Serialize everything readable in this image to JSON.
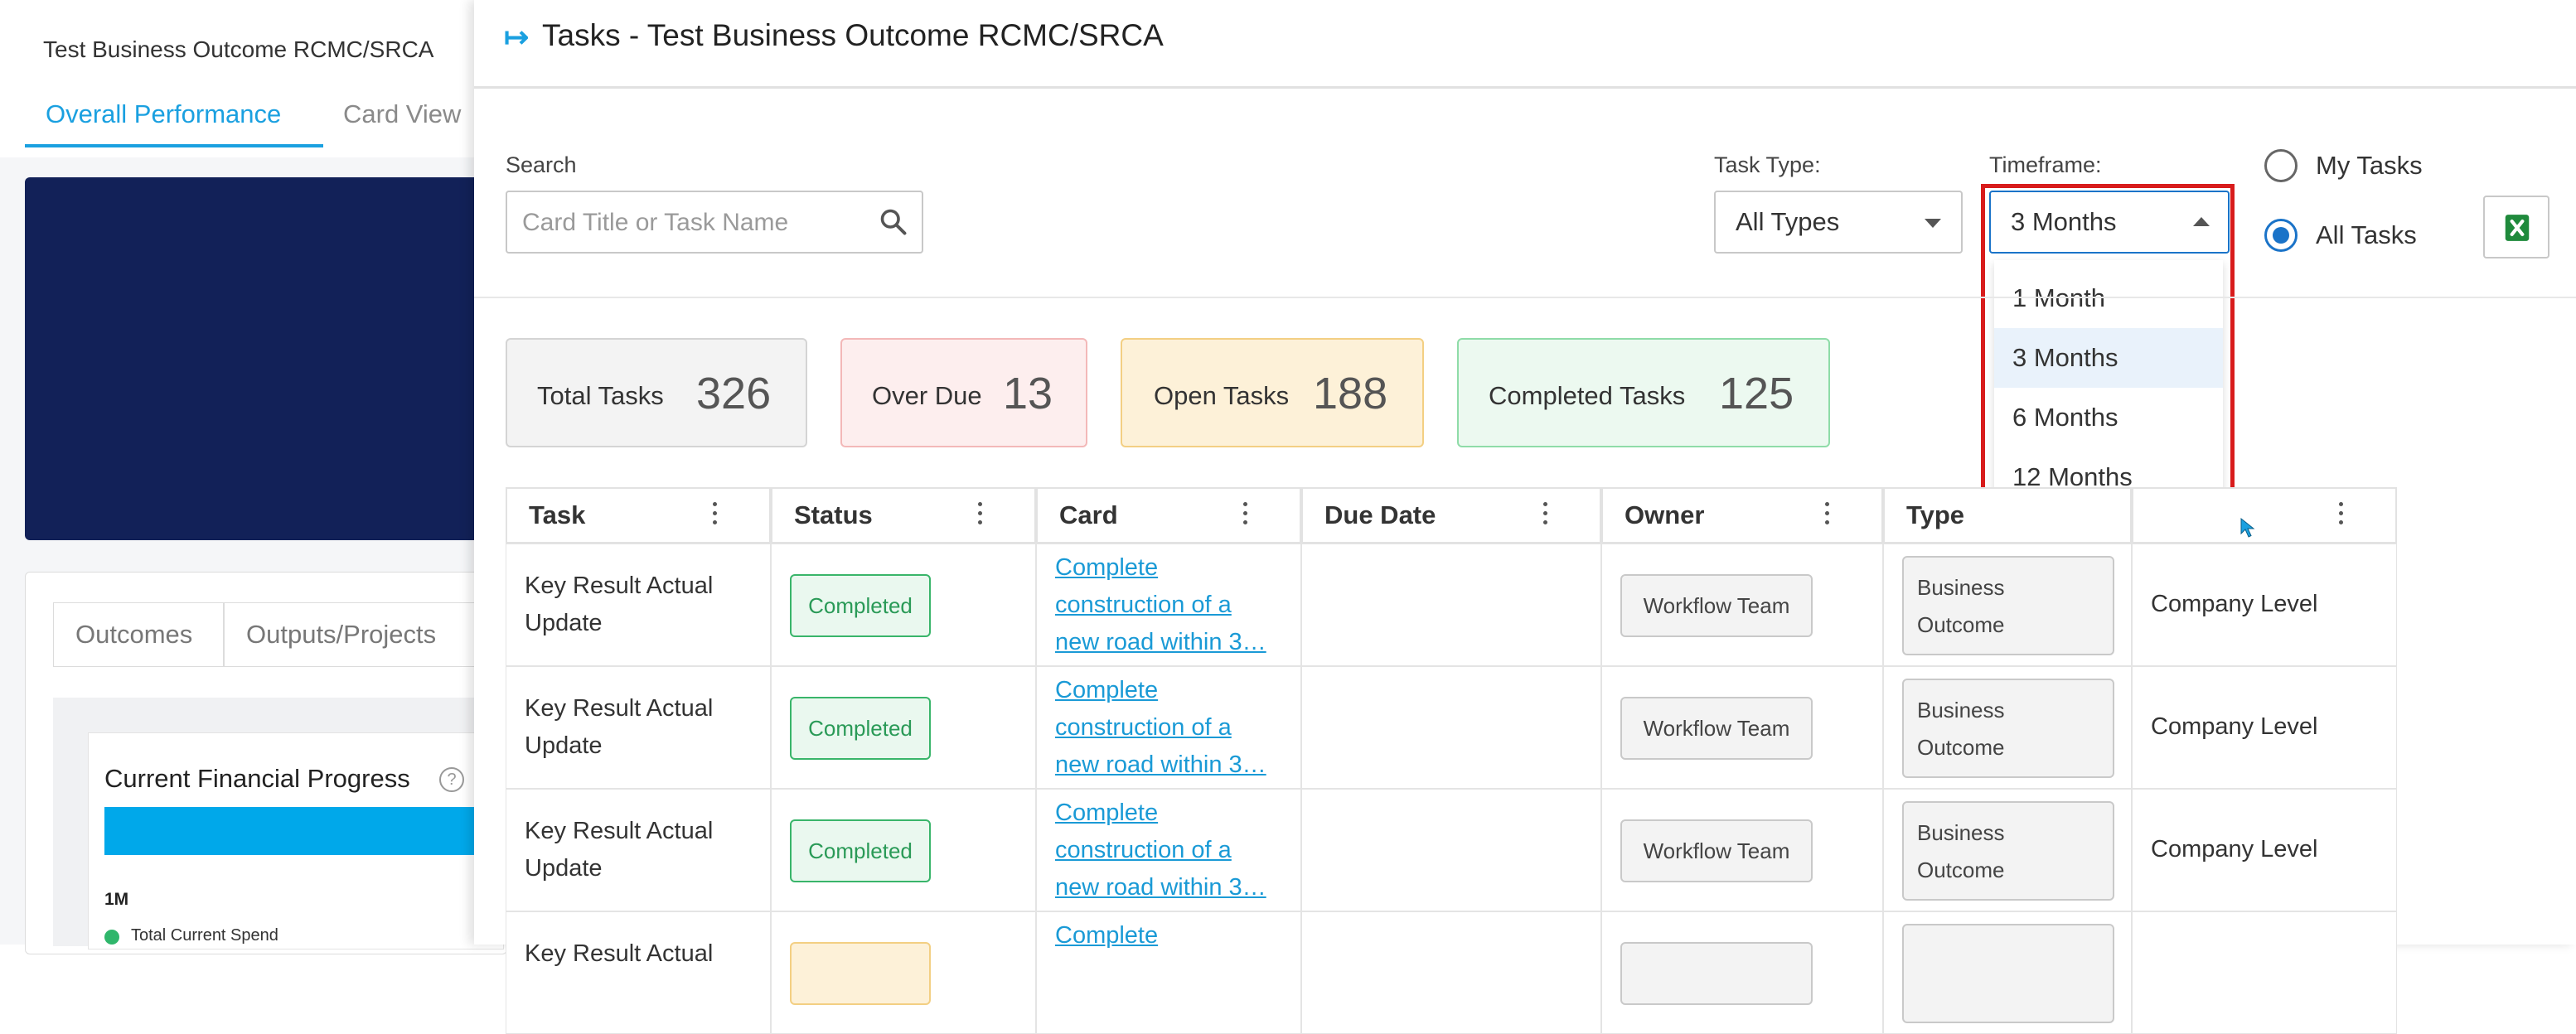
{
  "background": {
    "title": "Test Business Outcome RCMC/SRCA",
    "tabs": [
      {
        "label": "Overall Performance",
        "active": true
      },
      {
        "label": "Card View",
        "active": false
      }
    ],
    "subtabs": [
      "Outcomes",
      "Outputs/Projects"
    ],
    "panel_title": "Current Financial Progress",
    "scale_label": "1M",
    "legend": "Total Current Spend"
  },
  "drawer": {
    "title": "Tasks - Test Business Outcome RCMC/SRCA",
    "search": {
      "label": "Search",
      "placeholder": "Card Title or Task Name"
    },
    "task_type": {
      "label": "Task Type:",
      "value": "All Types"
    },
    "timeframe": {
      "label": "Timeframe:",
      "value": "3 Months",
      "options": [
        "1 Month",
        "3 Months",
        "6 Months",
        "12 Months"
      ],
      "selected_index": 1
    },
    "radios": [
      {
        "label": "My Tasks",
        "checked": false
      },
      {
        "label": "All Tasks",
        "checked": true
      }
    ],
    "stats": [
      {
        "label": "Total Tasks",
        "value": "326"
      },
      {
        "label": "Over Due",
        "value": "13"
      },
      {
        "label": "Open Tasks",
        "value": "188"
      },
      {
        "label": "Completed Tasks",
        "value": "125"
      }
    ],
    "table": {
      "columns": [
        "Task",
        "Status",
        "Card",
        "Due Date",
        "Owner",
        "Type",
        ""
      ],
      "rows": [
        {
          "task": [
            "Key Result Actual",
            "Update"
          ],
          "status": "Completed",
          "card": [
            "Complete",
            "construction of a",
            "new road within 3…"
          ],
          "due": "",
          "owner": "Workflow Team",
          "type": [
            "Business",
            "Outcome"
          ],
          "level": "Company Level"
        },
        {
          "task": [
            "Key Result Actual",
            "Update"
          ],
          "status": "Completed",
          "card": [
            "Complete",
            "construction of a",
            "new road within 3…"
          ],
          "due": "",
          "owner": "Workflow Team",
          "type": [
            "Business",
            "Outcome"
          ],
          "level": "Company Level"
        },
        {
          "task": [
            "Key Result Actual",
            "Update"
          ],
          "status": "Completed",
          "card": [
            "Complete",
            "construction of a",
            "new road within 3…"
          ],
          "due": "",
          "owner": "Workflow Team",
          "type": [
            "Business",
            "Outcome"
          ],
          "level": "Company Level"
        },
        {
          "task": [
            "Key Result Actual",
            ""
          ],
          "status": "",
          "card": [
            "Complete",
            "",
            ""
          ],
          "due": "",
          "owner": "",
          "type": [
            "",
            ""
          ],
          "level": ""
        }
      ]
    }
  },
  "colors": {
    "accent": "#1aa0e0",
    "banner": "#122158",
    "highlight": "#d81c1c",
    "excel": "#1f8a3c"
  }
}
